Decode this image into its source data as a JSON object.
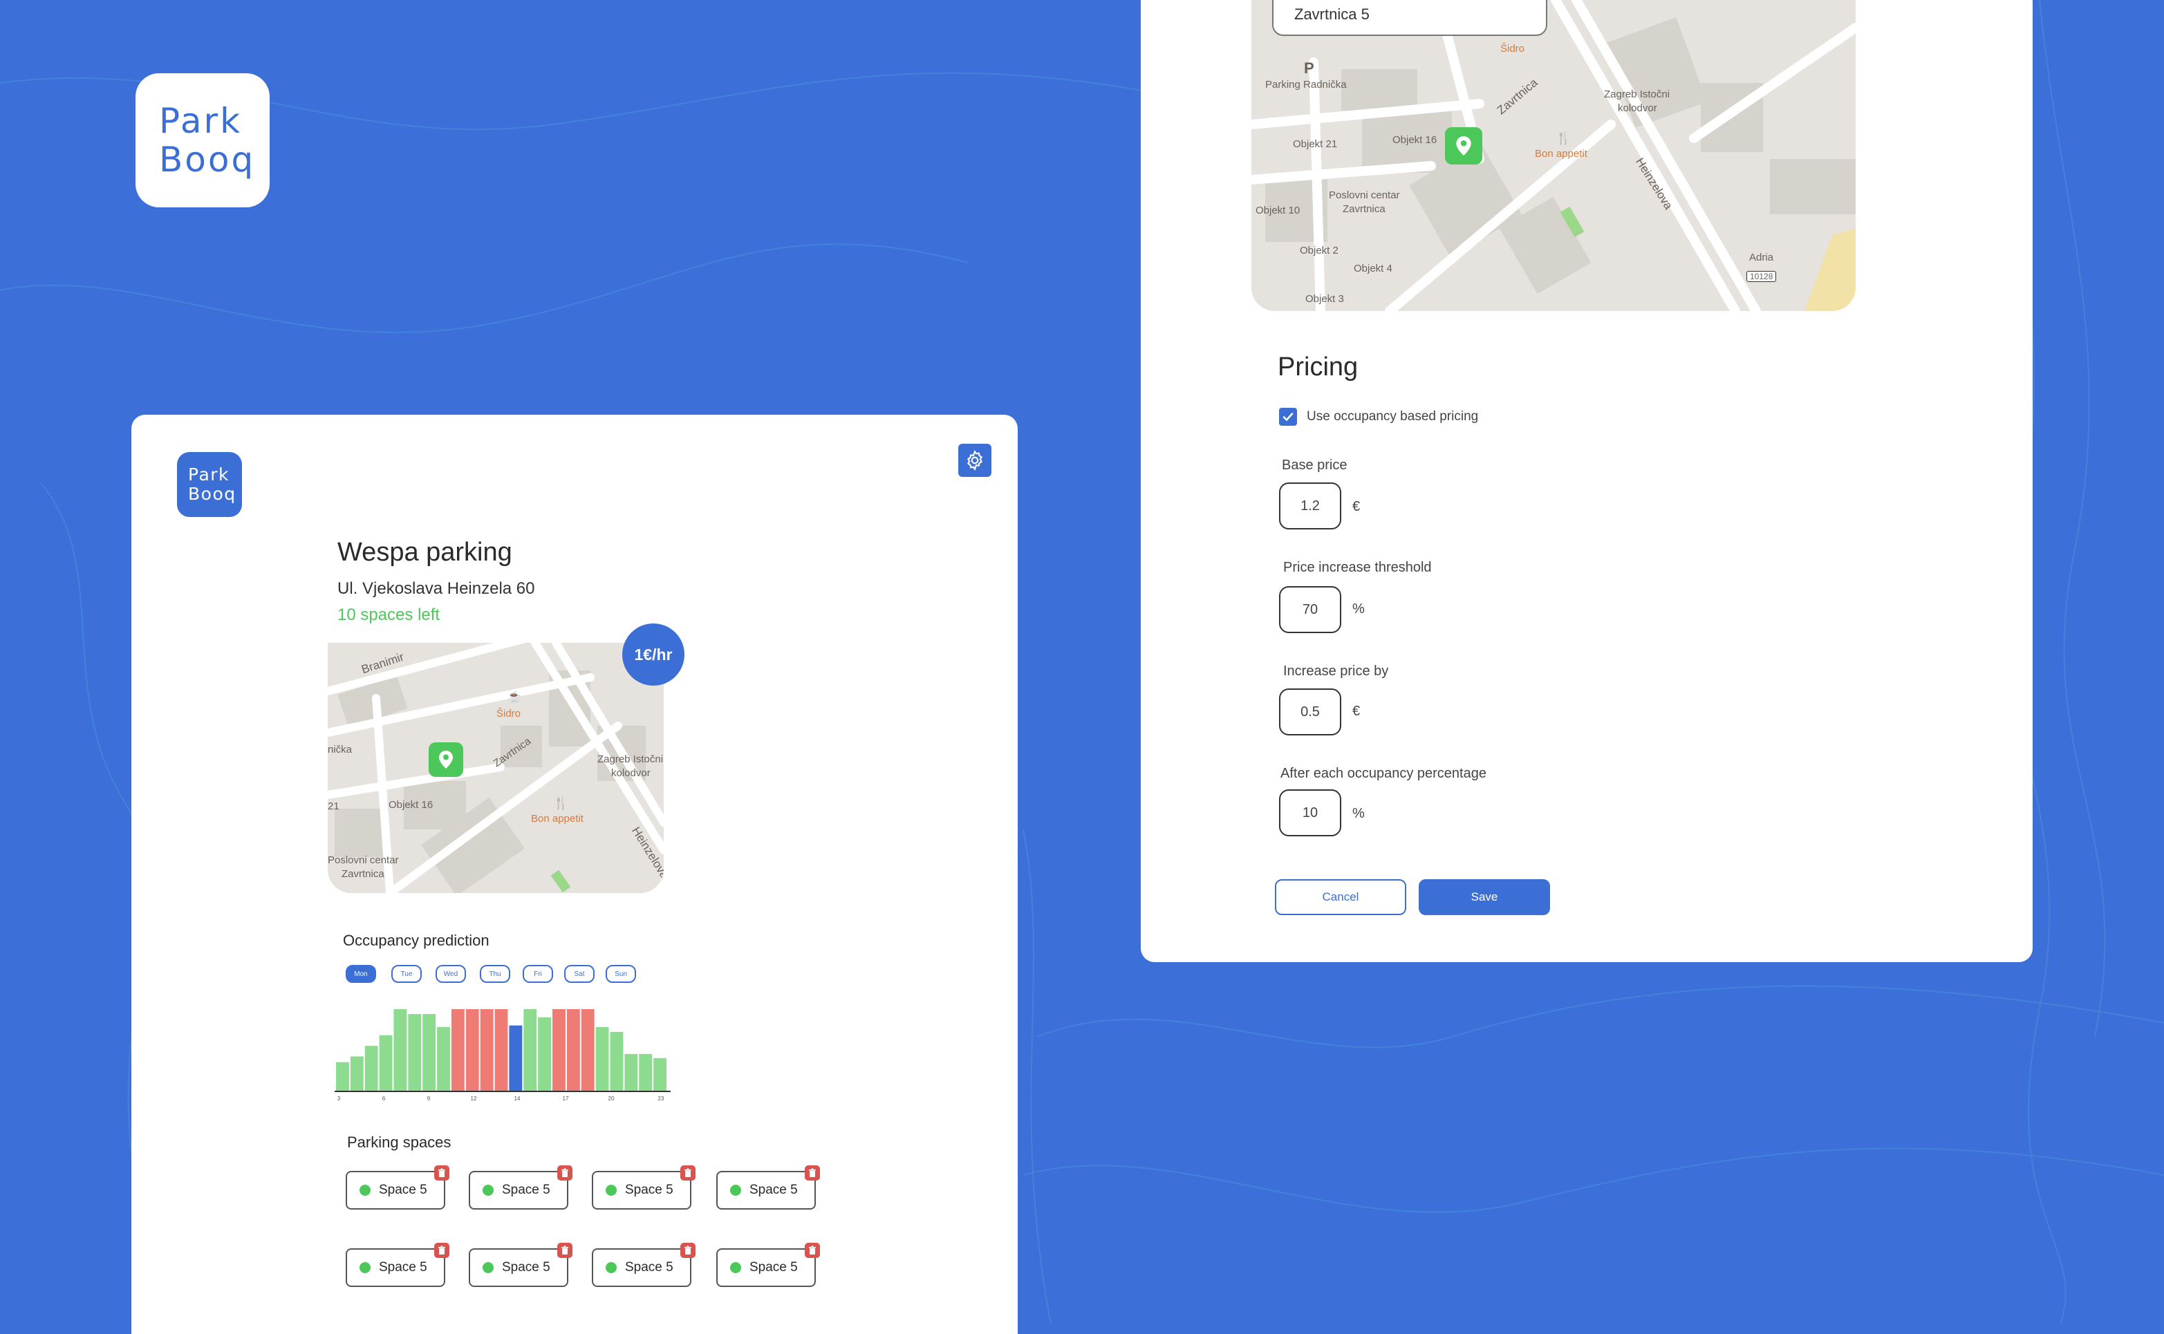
{
  "brand": {
    "logo_line1": "Park",
    "logo_line2": "Booq"
  },
  "colors": {
    "primary": "#3b6fd6",
    "available": "#4cc85a",
    "occupied": "#ee7b74",
    "free": "#8ddb8f",
    "delete": "#d9534f"
  },
  "lot": {
    "name": "Wespa parking",
    "address": "Ul. Vjekoslava Heinzela 60",
    "spaces_left": "10 spaces left",
    "price_badge": "1€/hr"
  },
  "left_map": {
    "labels": [
      "Branimir",
      "Šidro",
      "nička",
      "Zavrtnica",
      "Zagreb Istočni",
      "kolodvor",
      "Objekt 16",
      "Bon appetit",
      "Poslovni centar",
      "Zavrtnica",
      "Heinzelova",
      "21"
    ]
  },
  "occupancy": {
    "title": "Occupancy prediction",
    "days": [
      "Mon",
      "Tue",
      "Wed",
      "Thu",
      "Fri",
      "Sat",
      "Sun"
    ],
    "selected_day": "Mon"
  },
  "chart_data": {
    "type": "bar",
    "title": "Occupancy prediction",
    "x_ticks": [
      "3",
      "6",
      "9",
      "12",
      "14",
      "17",
      "20",
      "23"
    ],
    "hours": [
      3,
      4,
      5,
      6,
      7,
      8,
      9,
      10,
      11,
      12,
      13,
      14,
      15,
      16,
      17,
      18,
      19,
      20,
      21,
      22,
      23
    ],
    "values": [
      35,
      42,
      55,
      68,
      100,
      94,
      94,
      78,
      100,
      100,
      100,
      100,
      80,
      100,
      90,
      100,
      100,
      100,
      78,
      72,
      45,
      45,
      40
    ],
    "status": [
      "free",
      "free",
      "free",
      "free",
      "free",
      "free",
      "free",
      "free",
      "full",
      "full",
      "full",
      "full",
      "current",
      "free",
      "free",
      "full",
      "full",
      "full",
      "free",
      "free",
      "free",
      "free",
      "free"
    ],
    "ylim": [
      0,
      100
    ]
  },
  "parking_spaces": {
    "title": "Parking spaces",
    "items": [
      "Space 5",
      "Space 5",
      "Space 5",
      "Space 5",
      "Space 5",
      "Space 5",
      "Space 5",
      "Space 5"
    ]
  },
  "right_map": {
    "search_value": "Zavrtnica 5",
    "labels": [
      "Šidro",
      "P",
      "Parking Radnička",
      "Zavrtnica",
      "Zagreb Istočni",
      "kolodvor",
      "Objekt 21",
      "Objekt 16",
      "Bon appetit",
      "Objekt 10",
      "Poslovni centar",
      "Zavrtnica",
      "Heinzelova",
      "Objekt 2",
      "Objekt 4",
      "Adria",
      "10128",
      "Objekt 3"
    ]
  },
  "pricing": {
    "title": "Pricing",
    "occupancy_checkbox_label": "Use occupancy based pricing",
    "base_price_label": "Base price",
    "base_price_value": "1.2",
    "base_price_unit": "€",
    "threshold_label": "Price increase threshold",
    "threshold_value": "70",
    "threshold_unit": "%",
    "increase_label": "Increase price by",
    "increase_value": "0.5",
    "increase_unit": "€",
    "step_label": "After each occupancy percentage",
    "step_value": "10",
    "step_unit": "%",
    "cancel_label": "Cancel",
    "save_label": "Save"
  }
}
